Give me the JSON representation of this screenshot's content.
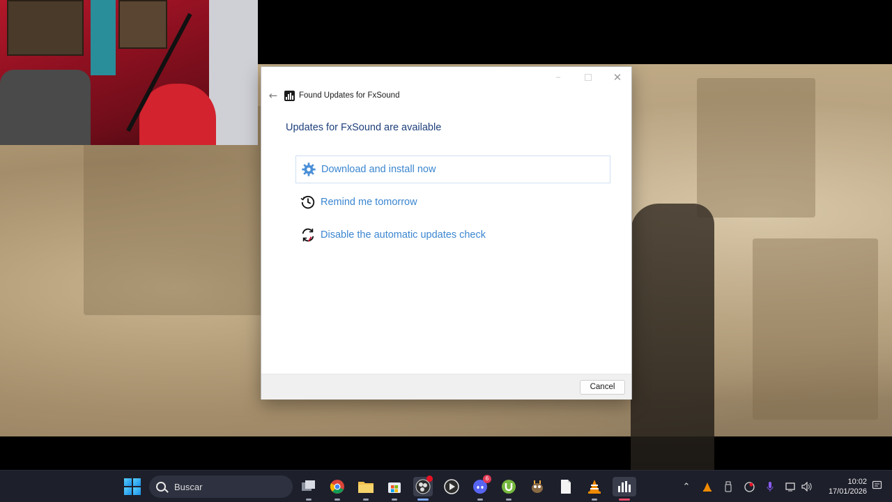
{
  "dialog": {
    "window_title": "Found Updates for FxSound",
    "main_instruction": "Updates for FxSound are available",
    "commands": [
      {
        "label": "Download and install now",
        "icon": "gear-icon"
      },
      {
        "label": "Remind me tomorrow",
        "icon": "clock-history-icon"
      },
      {
        "label": "Disable the automatic updates check",
        "icon": "disable-sync-icon"
      }
    ],
    "cancel_label": "Cancel",
    "link_color": "#3b86d0",
    "instruction_color": "#1d3f7a"
  },
  "taskbar": {
    "search_placeholder": "Buscar",
    "apps": [
      {
        "name": "task-view-icon"
      },
      {
        "name": "chrome-icon"
      },
      {
        "name": "file-explorer-icon"
      },
      {
        "name": "microsoft-store-icon"
      },
      {
        "name": "obs-icon"
      },
      {
        "name": "media-player-icon"
      },
      {
        "name": "discord-icon",
        "badge": "6"
      },
      {
        "name": "utorrent-icon"
      },
      {
        "name": "gimp-icon"
      },
      {
        "name": "notepad-icon"
      },
      {
        "name": "vlc-icon"
      },
      {
        "name": "fxsound-icon"
      }
    ],
    "clock_time": "10:02",
    "clock_date": "17/01/2026"
  }
}
